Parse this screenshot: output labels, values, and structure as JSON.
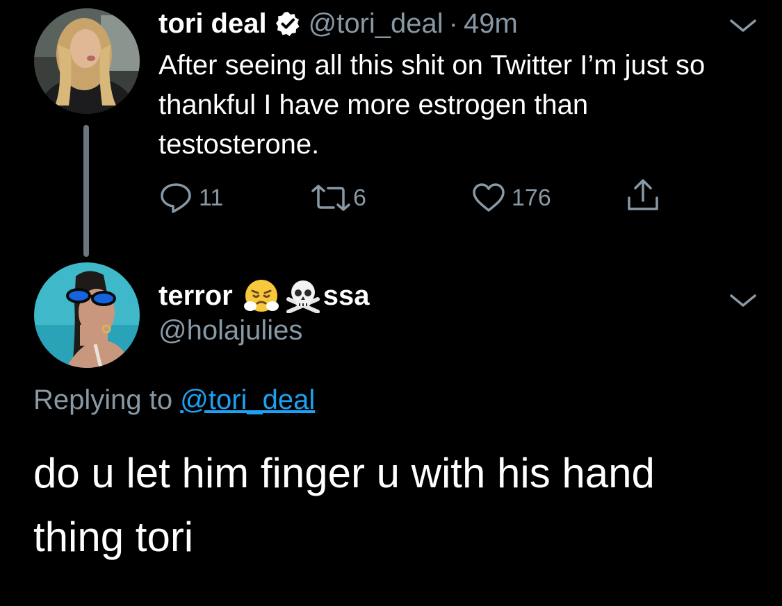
{
  "theme": {
    "background": "#000000",
    "text": "#ffffff",
    "muted": "#8899a6",
    "link": "#1da1f2",
    "thread_line": "#6e767d"
  },
  "tweet": {
    "author": {
      "name": "tori deal",
      "verified": true,
      "handle": "@tori_deal",
      "avatar": "avatar-photo"
    },
    "separator": "·",
    "time": "49m",
    "text": "After seeing all this shit on Twitter I’m just so thankful I have more estrogen than testosterone.",
    "actions": {
      "reply": {
        "icon": "reply-icon",
        "count": "11"
      },
      "retweet": {
        "icon": "retweet-icon",
        "count": "6"
      },
      "like": {
        "icon": "heart-icon",
        "count": "176"
      },
      "share": {
        "icon": "share-icon"
      }
    },
    "menu_icon": "chevron-down-icon"
  },
  "reply": {
    "author": {
      "name_start": "terror",
      "emojis": [
        "face-with-steam-from-nose-emoji",
        "skull-and-crossbones-emoji"
      ],
      "name_end": "ssa",
      "handle": "@holajulies",
      "avatar": "avatar-photo"
    },
    "replying_to_label": "Replying to",
    "replying_to_handle": "@tori_deal",
    "text": "do u let him finger u with his hand thing tori",
    "menu_icon": "chevron-down-icon"
  }
}
